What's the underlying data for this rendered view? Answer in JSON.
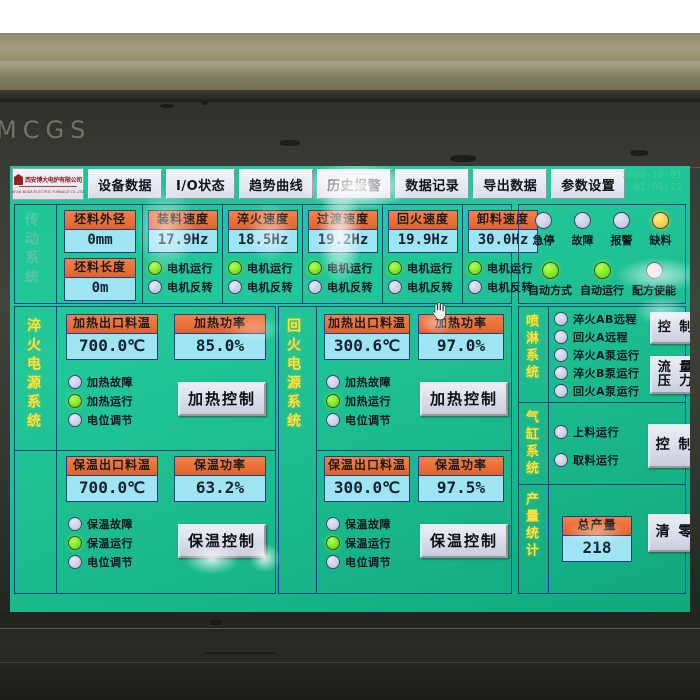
{
  "device": {
    "brand": "MCGS",
    "screen_title": "设备数据"
  },
  "header": {
    "logo_cn": "西安博大电炉有限公司",
    "logo_en": "XI'AN BODA ELECTRIC FURNACE CO.,LTD",
    "tabs": [
      {
        "label": "设备数据",
        "active": true
      },
      {
        "label": "I/O状态",
        "active": false
      },
      {
        "label": "趋势曲线",
        "active": false
      },
      {
        "label": "历史报警",
        "active": false
      },
      {
        "label": "数据记录",
        "active": false
      },
      {
        "label": "导出数据",
        "active": false
      },
      {
        "label": "参数设置",
        "active": false
      }
    ],
    "date": "2000-10-01",
    "time": "01:05:22"
  },
  "drive_system": {
    "vlabel": "传动系统",
    "billet": [
      {
        "title": "坯料外径",
        "value": "0mm"
      },
      {
        "title": "坯料长度",
        "value": "0m"
      }
    ],
    "speeds": [
      {
        "title": "装料速度",
        "value": "17.9Hz",
        "run_label": "电机运行",
        "run_on": true,
        "rev_label": "电机反转",
        "rev_on": false
      },
      {
        "title": "淬火速度",
        "value": "18.5Hz",
        "run_label": "电机运行",
        "run_on": true,
        "rev_label": "电机反转",
        "rev_on": false
      },
      {
        "title": "过渡速度",
        "value": "19.2Hz",
        "run_label": "电机运行",
        "run_on": true,
        "rev_label": "电机反转",
        "rev_on": false
      },
      {
        "title": "回火速度",
        "value": "19.9Hz",
        "run_label": "电机运行",
        "run_on": true,
        "rev_label": "电机反转",
        "rev_on": false
      },
      {
        "title": "卸料速度",
        "value": "30.0Hz",
        "run_label": "电机运行",
        "run_on": true,
        "rev_label": "电机反转",
        "rev_on": false
      }
    ]
  },
  "quench_power": {
    "vlabel": "淬火电源系统",
    "heat": {
      "temp_title": "加热出口料温",
      "temp_value": "700.0℃",
      "power_title": "加热功率",
      "power_value": "85.0%",
      "button": "加热控制",
      "lamps": [
        {
          "label": "加热故障",
          "on": false
        },
        {
          "label": "加热运行",
          "on": true
        },
        {
          "label": "电位调节",
          "on": false
        }
      ]
    },
    "hold": {
      "temp_title": "保温出口料温",
      "temp_value": "700.0℃",
      "power_title": "保温功率",
      "power_value": "63.2%",
      "button": "保温控制",
      "lamps": [
        {
          "label": "保温故障",
          "on": false
        },
        {
          "label": "保温运行",
          "on": true
        },
        {
          "label": "电位调节",
          "on": false
        }
      ]
    }
  },
  "temper_power": {
    "vlabel": "回火电源系统",
    "heat": {
      "temp_title": "加热出口料温",
      "temp_value": "300.6℃",
      "power_title": "加热功率",
      "power_value": "97.0%",
      "button": "加热控制",
      "lamps": [
        {
          "label": "加热故障",
          "on": false
        },
        {
          "label": "加热运行",
          "on": true
        },
        {
          "label": "电位调节",
          "on": false
        }
      ]
    },
    "hold": {
      "temp_title": "保温出口料温",
      "temp_value": "300.0℃",
      "power_title": "保温功率",
      "power_value": "97.5%",
      "button": "保温控制",
      "lamps": [
        {
          "label": "保温故障",
          "on": false
        },
        {
          "label": "保温运行",
          "on": true
        },
        {
          "label": "电位调节",
          "on": false
        }
      ]
    }
  },
  "status_panel": {
    "row1": [
      {
        "label": "急停",
        "state": "off"
      },
      {
        "label": "故障",
        "state": "off"
      },
      {
        "label": "报警",
        "state": "off"
      },
      {
        "label": "缺料",
        "state": "warn"
      }
    ],
    "row2": [
      {
        "label": "自动方式",
        "state": "on"
      },
      {
        "label": "自动运行",
        "state": "on"
      },
      {
        "label": "配方使能",
        "state": "pale"
      }
    ]
  },
  "spray_system": {
    "vlabel": "喷淋系统",
    "lamps": [
      {
        "label": "淬火AB远程",
        "on": false
      },
      {
        "label": "回火A远程",
        "on": false
      },
      {
        "label": "淬火A泵运行",
        "on": false
      },
      {
        "label": "淬火B泵运行",
        "on": false
      },
      {
        "label": "回火A泵运行",
        "on": false
      }
    ],
    "buttons": [
      "控 制",
      "流 量\n压 力"
    ],
    "button_control": "控 制",
    "button_flow_line1": "流 量",
    "button_flow_line2": "压 力"
  },
  "cylinder_system": {
    "vlabel": "气缸系统",
    "lamps": [
      {
        "label": "上料运行",
        "on": false
      },
      {
        "label": "取料运行",
        "on": false
      }
    ],
    "button_control": "控 制"
  },
  "production": {
    "vlabel": "产量统计",
    "total_title": "总产量",
    "total_value": "218",
    "button_clear": "清 零"
  }
}
